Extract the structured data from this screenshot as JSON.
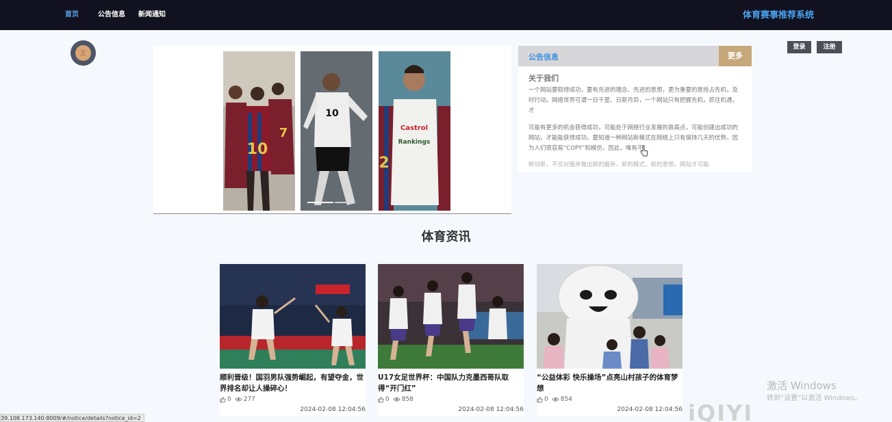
{
  "nav": {
    "items": [
      {
        "label": "首页",
        "active": true
      },
      {
        "label": "公告信息",
        "active": false
      },
      {
        "label": "新闻通知",
        "active": false
      }
    ],
    "site_title": "体育赛事推荐系统"
  },
  "auth": {
    "login_label": "登录",
    "register_label": "注册"
  },
  "carousel": {
    "slide_count": 3,
    "active_indicator": 2
  },
  "notice": {
    "header": "公告信息",
    "more_label": "更多",
    "subtitle": "关于我们",
    "para1": "一个网站要取得成功，要有先进的理念、先进的思想，更为重要的是抢占先机，及时行动。网络世界可谓一日千里、日新月异，一个网站只有把握先机，抓住机遇，才",
    "para2": "可能有更多的机会获得成功，可能处于网络行业发展的敦高点，可能创建出成功的网站，才能能获得成功。要知道一种网站新模式在网络上只有保持几天的优势，因为人们很容易“COPY”和模仿，因此，唯有不",
    "para3": "断创新，不仅对服务做出新的服务、新的模式，新的思想，网站才可能"
  },
  "section_title": "体育资讯",
  "news": [
    {
      "title": "顺利晋级！国羽男队强势崛起，有望夺金，世界排名却让人操碎心！",
      "likes": "0",
      "views": "277",
      "date": "2024-02-08 12:04:56"
    },
    {
      "title": "U17女足世界杯：中国队力克墨西哥队取得“开门红”",
      "likes": "0",
      "views": "858",
      "date": "2024-02-08 12:04:56"
    },
    {
      "title": "“公益体彩 快乐操场”点亮山村孩子的体育梦想",
      "likes": "0",
      "views": "854",
      "date": "2024-02-08 12:04:56"
    }
  ],
  "status_url": "39.108.173.140:8009/#/notice/details?notice_id=2",
  "watermark": {
    "line1": "激活 Windows",
    "line2": "转到“设置”以激活 Windows。",
    "brand": "iQIYI"
  },
  "colors": {
    "topbar": "#11111f",
    "accent": "#4aa3ef",
    "more_button": "#c7a87b"
  }
}
